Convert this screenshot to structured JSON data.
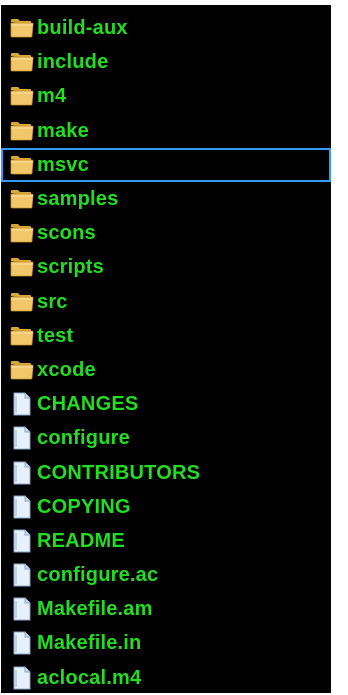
{
  "file_list": {
    "items": [
      {
        "name": "build-aux",
        "type": "folder",
        "selected": false
      },
      {
        "name": "include",
        "type": "folder",
        "selected": false
      },
      {
        "name": "m4",
        "type": "folder",
        "selected": false
      },
      {
        "name": "make",
        "type": "folder",
        "selected": false
      },
      {
        "name": "msvc",
        "type": "folder",
        "selected": true
      },
      {
        "name": "samples",
        "type": "folder",
        "selected": false
      },
      {
        "name": "scons",
        "type": "folder",
        "selected": false
      },
      {
        "name": "scripts",
        "type": "folder",
        "selected": false
      },
      {
        "name": "src",
        "type": "folder",
        "selected": false
      },
      {
        "name": "test",
        "type": "folder",
        "selected": false
      },
      {
        "name": "xcode",
        "type": "folder",
        "selected": false
      },
      {
        "name": "CHANGES",
        "type": "file",
        "selected": false
      },
      {
        "name": "configure",
        "type": "file",
        "selected": false
      },
      {
        "name": "CONTRIBUTORS",
        "type": "file",
        "selected": false
      },
      {
        "name": "COPYING",
        "type": "file",
        "selected": false
      },
      {
        "name": "README",
        "type": "file",
        "selected": false
      },
      {
        "name": "configure.ac",
        "type": "file",
        "selected": false
      },
      {
        "name": "Makefile.am",
        "type": "file",
        "selected": false
      },
      {
        "name": "Makefile.in",
        "type": "file",
        "selected": false
      },
      {
        "name": "aclocal.m4",
        "type": "file",
        "selected": false
      }
    ]
  },
  "colors": {
    "background": "#000000",
    "label_text": "#22dd22",
    "selection_border": "#3399ff",
    "folder_icon": "#f2c76a",
    "file_icon": "#e8f1fb"
  }
}
